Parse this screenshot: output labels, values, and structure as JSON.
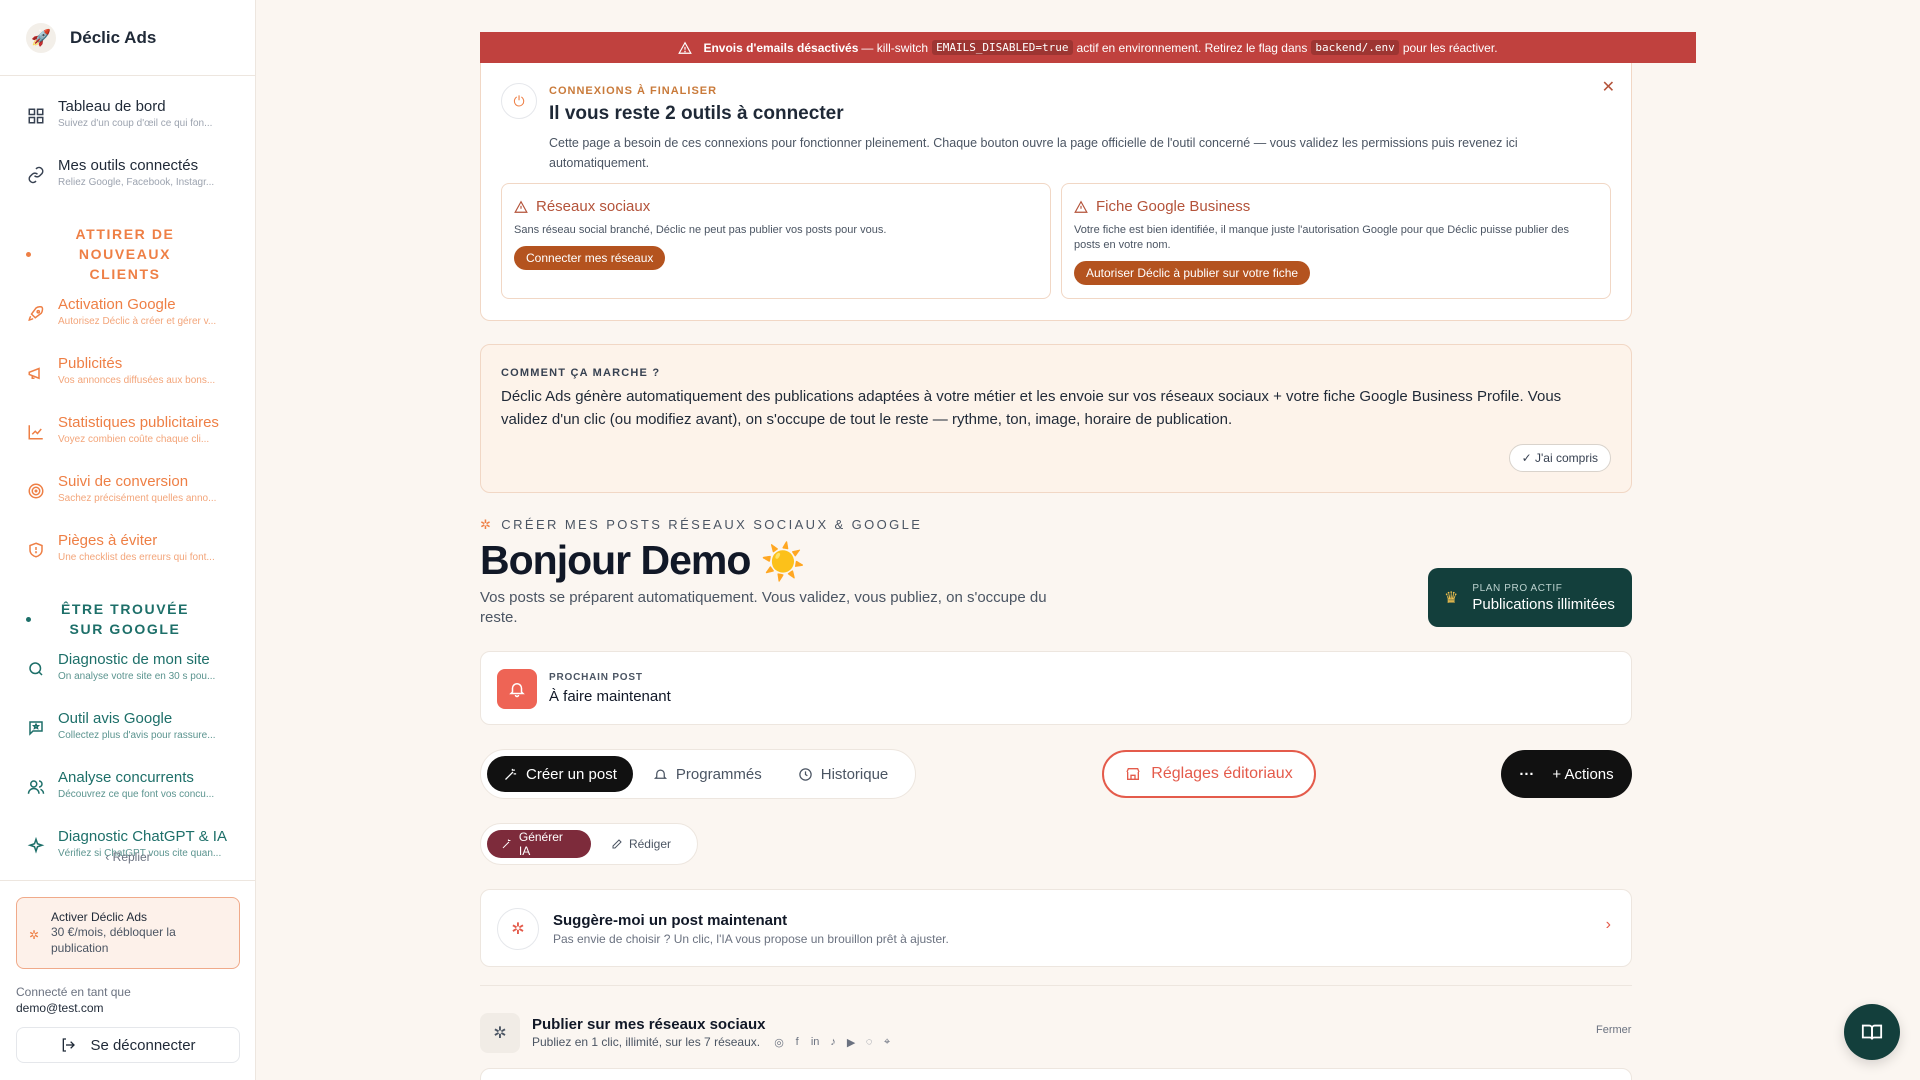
{
  "brand": {
    "name": "Déclic Ads",
    "logo_icon": "rocket-icon"
  },
  "sidebar": {
    "top_items": [
      {
        "title": "Tableau de bord",
        "sub": "Suivez d'un coup d'œil ce qui fon...",
        "icon": "grid-icon"
      },
      {
        "title": "Mes outils connectés",
        "sub": "Reliez Google, Facebook, Instagr...",
        "icon": "link-icon"
      }
    ],
    "section_attirer": "ATTIRER DE NOUVEAUX CLIENTS",
    "attirer_items": [
      {
        "title": "Activation Google",
        "sub": "Autorisez Déclic à créer et gérer v...",
        "icon": "rocket-icon"
      },
      {
        "title": "Publicités",
        "sub": "Vos annonces diffusées aux bons...",
        "icon": "megaphone-icon"
      },
      {
        "title": "Statistiques publicitaires",
        "sub": "Voyez combien coûte chaque cli...",
        "icon": "chart-line-icon"
      },
      {
        "title": "Suivi de conversion",
        "sub": "Sachez précisément quelles anno...",
        "icon": "target-icon"
      },
      {
        "title": "Pièges à éviter",
        "sub": "Une checklist des erreurs qui font...",
        "icon": "shield-icon"
      }
    ],
    "section_trouvee": "ÊTRE TROUVÉE SUR GOOGLE",
    "trouvee_items": [
      {
        "title": "Diagnostic de mon site",
        "sub": "On analyse votre site en 30 s pou...",
        "icon": "search-icon"
      },
      {
        "title": "Outil avis Google",
        "sub": "Collectez plus d'avis pour rassure...",
        "icon": "message-star-icon"
      },
      {
        "title": "Analyse concurrents",
        "sub": "Découvrez ce que font vos concu...",
        "icon": "users-icon"
      },
      {
        "title": "Diagnostic ChatGPT & IA",
        "sub": "Vérifiez si ChatGPT vous cite quan...",
        "icon": "sparkles-icon"
      }
    ],
    "collapse_label": "Replier",
    "activate_title": "Activer Déclic Ads",
    "activate_sub": "30 €/mois, débloquer la publication",
    "logged_label": "Connecté en tant que",
    "logged_email": "demo@test.com",
    "logout_label": "Se déconnecter"
  },
  "alert": {
    "bold": "Envois d'emails désactivés",
    "text1": "— kill-switch",
    "code1": "EMAILS_DISABLED=true",
    "text2": "actif en environnement. Retirez le flag dans",
    "code2": "backend/.env",
    "text3": "pour les réactiver."
  },
  "connexions": {
    "kicker": "CONNEXIONS À FINALISER",
    "title": "Il vous reste 2 outils à connecter",
    "desc": "Cette page a besoin de ces connexions pour fonctionner pleinement. Chaque bouton ouvre la page officielle de l'outil concerné — vous validez les permissions puis revenez ici automatiquement.",
    "cards": [
      {
        "title": "Réseaux sociaux",
        "desc": "Sans réseau social branché, Déclic ne peut pas publier vos posts pour vous.",
        "button": "Connecter mes réseaux"
      },
      {
        "title": "Fiche Google Business",
        "desc": "Votre fiche est bien identifiée, il manque juste l'autorisation Google pour que Déclic puisse publier des posts en votre nom.",
        "button": "Autoriser Déclic à publier sur votre fiche"
      }
    ]
  },
  "howto": {
    "kicker": "COMMENT ÇA MARCHE ?",
    "text": "Déclic Ads génère automatiquement des publications adaptées à votre métier et les envoie sur vos réseaux sociaux + votre fiche Google Business Profile. Vous validez d'un clic (ou modifiez avant), on s'occupe de tout le reste — rythme, ton, image, horaire de publication.",
    "button": "J'ai compris"
  },
  "header": {
    "kicker": "CRÉER MES POSTS RÉSEAUX SOCIAUX & GOOGLE",
    "greeting": "Bonjour Demo",
    "emoji": "☀️",
    "sub": "Vos posts se préparent automatiquement. Vous validez, vous publiez, on s'occupe du reste."
  },
  "plan": {
    "kicker": "PLAN PRO ACTIF",
    "title": "Publications illimitées"
  },
  "next_post": {
    "kicker": "PROCHAIN POST",
    "title": "À faire maintenant"
  },
  "tabs": [
    {
      "label": "Créer un post",
      "icon": "wand-icon"
    },
    {
      "label": "Programmés",
      "icon": "bell-icon"
    },
    {
      "label": "Historique",
      "icon": "clock-icon"
    }
  ],
  "reglages_label": "Réglages éditoriaux",
  "actions_label": "+ Actions",
  "subtabs": [
    {
      "label": "Générer IA",
      "icon": "wand-icon"
    },
    {
      "label": "Rédiger",
      "icon": "pencil-icon"
    }
  ],
  "suggest": {
    "title": "Suggère-moi un post maintenant",
    "sub": "Pas envie de choisir ? Un clic, l'IA vous propose un brouillon prêt à ajuster."
  },
  "publish": {
    "title": "Publier sur mes réseaux sociaux",
    "sub": "Publiez en 1 clic, illimité, sur les 7 réseaux.",
    "close": "Fermer"
  },
  "colors": {
    "accent": "#ee7f45",
    "teal": "#1d6f69",
    "dark_green": "#133f3c",
    "alert_red": "#c0413e"
  }
}
